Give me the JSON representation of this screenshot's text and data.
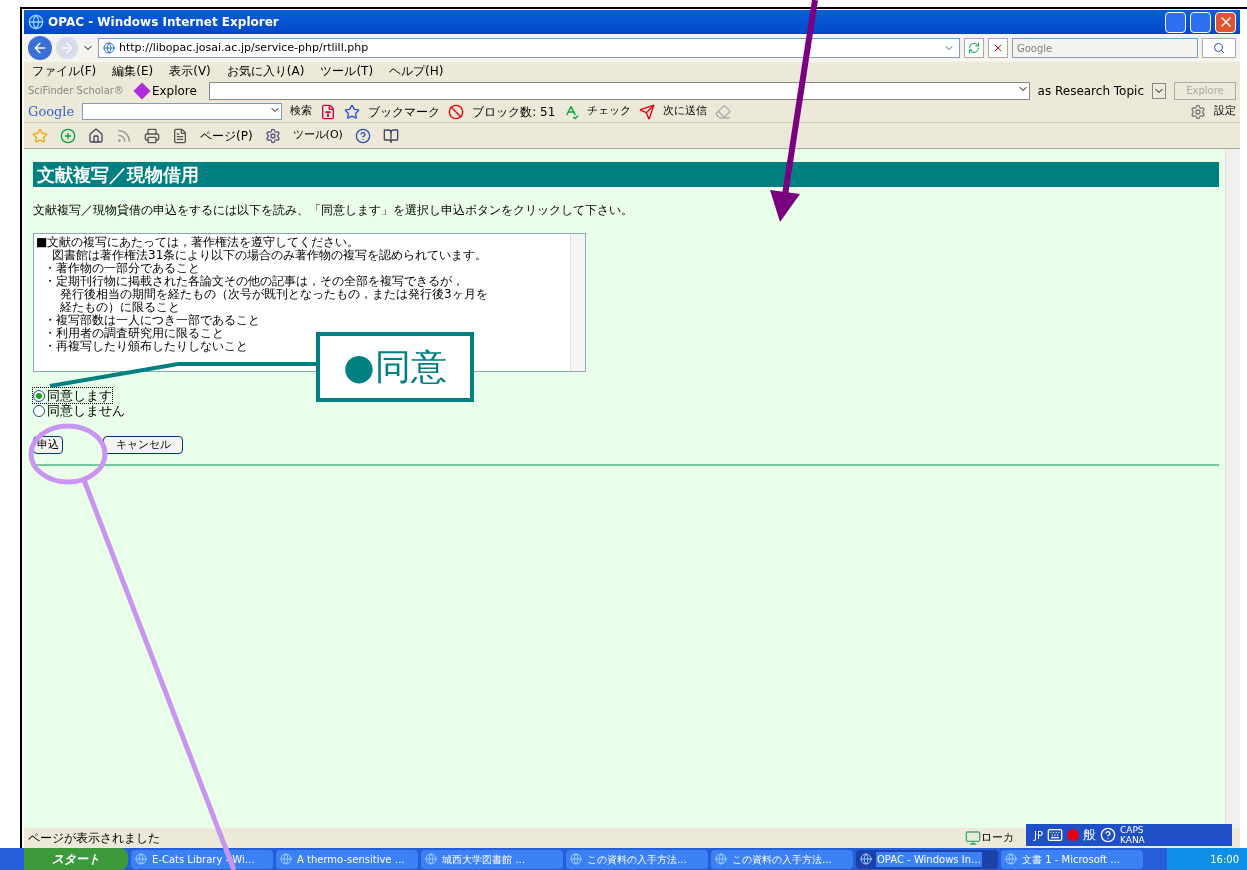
{
  "window": {
    "title": "OPAC - Windows Internet Explorer"
  },
  "address_bar": {
    "url": "http://libopac.josai.ac.jp/service-php/rtlill.php"
  },
  "search_field": {
    "placeholder": "Google"
  },
  "menu": [
    "ファイル(F)",
    "編集(E)",
    "表示(V)",
    "お気に入り(A)",
    "ツール(T)",
    "ヘルプ(H)"
  ],
  "scifinder_bar": {
    "label": "SciFinder Scholar®",
    "explore": "Explore",
    "topic": "as Research Topic",
    "explore_button": "Explore"
  },
  "google_toolbar": {
    "logo": "Google",
    "search": "検索",
    "bookmarks": "ブックマーク",
    "blocked": "ブロック数: 51",
    "check": "チェック",
    "send": "次に送信",
    "settings": "設定"
  },
  "command_bar": {
    "page": "ページ(P)",
    "tools": "ツール(O)"
  },
  "page": {
    "heading": "文献複写／現物借用",
    "instruction": "文献複写／現物貸借の申込をするには以下を読み、「同意します」を選択し申込ボタンをクリックして下さい。",
    "terms": [
      {
        "kind": "title",
        "text": "■文献の複写にあたっては，著作権法を遵守してください。"
      },
      {
        "kind": "note",
        "text": "図書館は著作権法31条により以下の場合のみ著作物の複写を認められています。"
      },
      {
        "kind": "bullet",
        "text": "・著作物の一部分であること"
      },
      {
        "kind": "bullet",
        "text": "・定期刊行物に掲載された各論文その他の記事は，その全部を複写できるが，"
      },
      {
        "kind": "continuation",
        "text": "発行後相当の期間を経たもの（次号が既刊となったもの，または発行後3ヶ月を"
      },
      {
        "kind": "continuation",
        "text": "経たもの）に限ること"
      },
      {
        "kind": "bullet",
        "text": "・複写部数は一人につき一部であること"
      },
      {
        "kind": "bullet",
        "text": "・利用者の調査研究用に限ること"
      },
      {
        "kind": "bullet",
        "text": "・再複写したり頒布したりしないこと"
      }
    ],
    "options": [
      {
        "label": "同意します",
        "selected": true
      },
      {
        "label": "同意しません",
        "selected": false
      }
    ],
    "buttons": [
      "申込",
      "キャンセル"
    ]
  },
  "annotation": {
    "callout": "●同意"
  },
  "status_bar": {
    "text": "ページが表示されました",
    "zone": "ローカ"
  },
  "language_bar": {
    "lang": "JP",
    "mode": "般",
    "caps": "CAPS",
    "kana": "KANA"
  },
  "taskbar": {
    "start": "スタート",
    "tasks": [
      {
        "label": "E-Cats Library - Wi…",
        "selected": false
      },
      {
        "label": "A thermo-sensitive …",
        "selected": false
      },
      {
        "label": "城西大学図書館 …",
        "selected": false
      },
      {
        "label": "この資料の入手方法…",
        "selected": false
      },
      {
        "label": "この資料の入手方法…",
        "selected": false
      },
      {
        "label": "OPAC - Windows In…",
        "selected": true
      },
      {
        "label": "文書 1 - Microsoft …",
        "selected": false
      }
    ],
    "clock": "16:00"
  }
}
